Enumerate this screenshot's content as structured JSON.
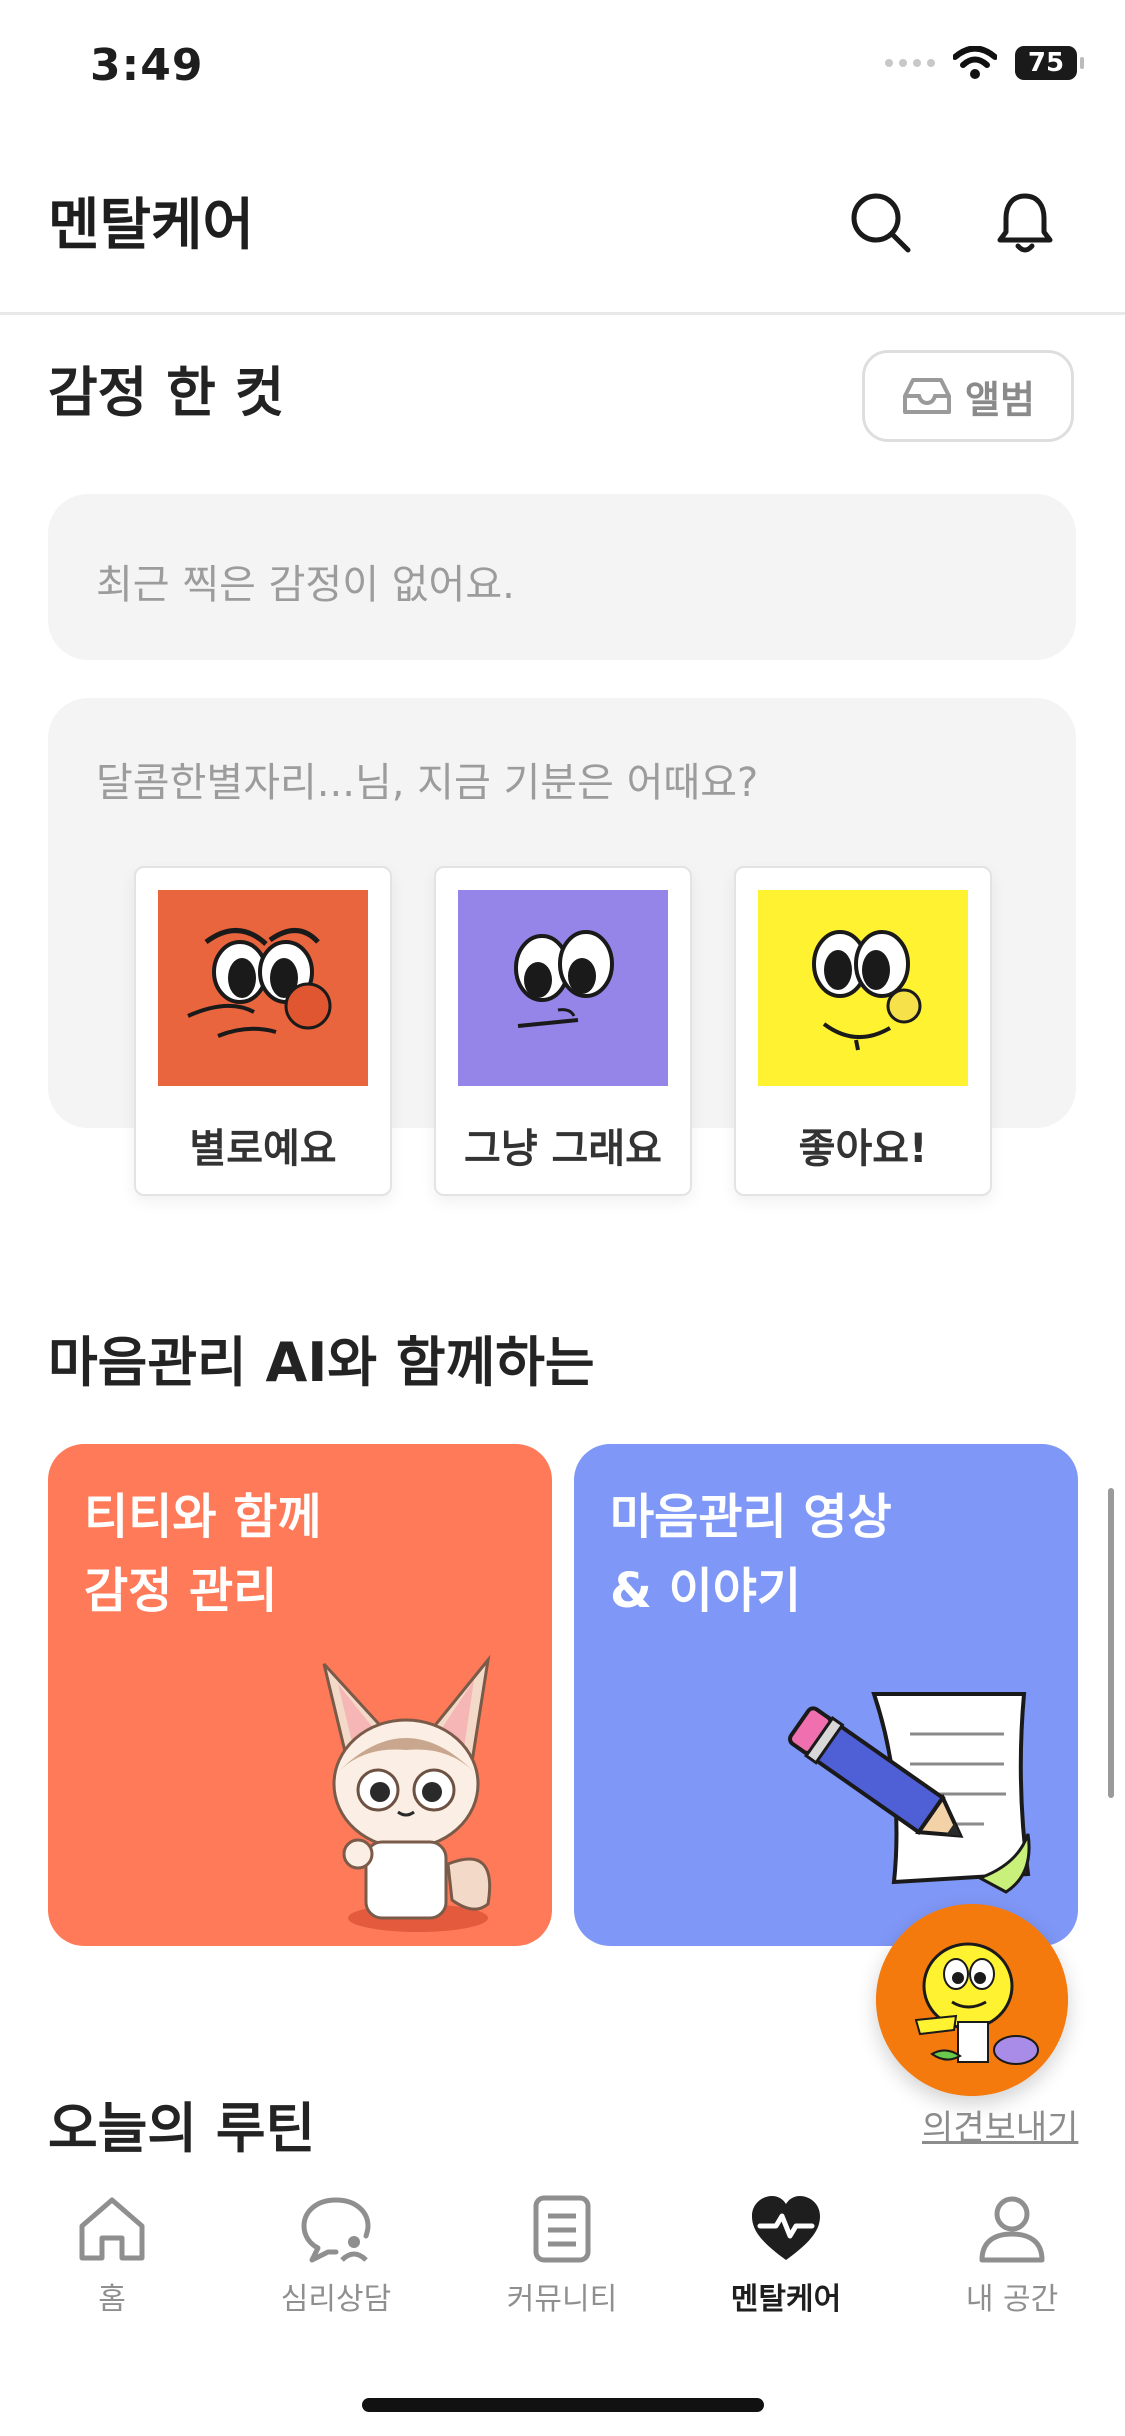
{
  "status_bar": {
    "time": "3:49",
    "battery": "75"
  },
  "header": {
    "title": "멘탈케어",
    "icons": [
      "search-icon",
      "bell-icon"
    ]
  },
  "emotion_snapshot": {
    "title": "감정 한 컷",
    "album_label": "앨범",
    "empty_message": "최근 찍은 감정이 없어요.",
    "mood_question": "달콤한별자리...님, 지금 기분은 어때요?",
    "moods": [
      {
        "label": "별로예요",
        "color": "#e8653d"
      },
      {
        "label": "그냥 그래요",
        "color": "#9585e8"
      },
      {
        "label": "좋아요!",
        "color": "#fff230"
      }
    ]
  },
  "ai_section": {
    "title": "마음관리 AI와 함께하는",
    "cards": [
      {
        "line1": "티티와 함께",
        "line2": "감정 관리",
        "color": "#ff7a58"
      },
      {
        "line1": "마음관리 영상",
        "line2": "& 이야기",
        "color": "#7f97f6"
      }
    ]
  },
  "routine": {
    "title": "오늘의 루틴",
    "feedback_label": "의견보내기"
  },
  "tabbar": {
    "tabs": [
      {
        "label": "홈",
        "icon": "home-icon"
      },
      {
        "label": "심리상담",
        "icon": "chat-counsel-icon"
      },
      {
        "label": "커뮤니티",
        "icon": "document-icon"
      },
      {
        "label": "멘탈케어",
        "icon": "heart-pulse-icon",
        "active": true
      },
      {
        "label": "내 공간",
        "icon": "person-icon"
      }
    ]
  }
}
